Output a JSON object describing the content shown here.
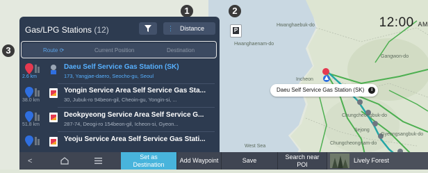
{
  "clock": {
    "time": "12:00",
    "ampm": "AM"
  },
  "panel": {
    "title": "Gas/LPG Stations",
    "count": "(12)",
    "sort_label": "Distance",
    "tabs": [
      "Route",
      "Current Position",
      "Destination"
    ]
  },
  "stations": [
    {
      "distance": "2.6 km",
      "name": "Daeu Self Service Gas Station (SK)",
      "address": "173, Yangjae-daero, Seocho-gu, Seoul"
    },
    {
      "distance": "38.0 km",
      "name": "Yongin Service Area Self Service Gas Sta...",
      "address": "30, Jubuk-ro 94beon-gil, Cheoin-gu, Yongin-si, ..."
    },
    {
      "distance": "51.8 km",
      "name": "Deokpyeong Service Area Self Service G...",
      "address": "287-74, Deogi-ro 154beon-gil, Icheon-si, Gyeon..."
    },
    {
      "distance": "",
      "name": "Yeoju Service Area Self Service Gas Stati...",
      "address": ""
    }
  ],
  "map": {
    "tooltip": "Daeu Self Service Gas Station (SK)",
    "labels": [
      "Hwanghaebuk-do",
      "Hwanghaenam-do",
      "Gangwon-do",
      "Incheon",
      "Chungcheongbuk-do",
      "Sejong",
      "Gyeongsangbuk-do",
      "Chungcheongnam-do",
      "West Sea"
    ]
  },
  "callouts": [
    "1",
    "2",
    "3"
  ],
  "parking_button": "P",
  "bottom_bar": {
    "set_destination": [
      "Set as",
      "Destination"
    ],
    "add_waypoint": "Add Waypoint",
    "save": "Save",
    "search_near_poi": [
      "Search near",
      "POI"
    ],
    "lively_forest": "Lively Forest"
  },
  "colors": {
    "panel_bg": "#2d3b50",
    "accent_blue": "#57b0ff",
    "set_dest_bg": "#48b4dc",
    "bottom_bar_bg": "#3f4552"
  },
  "icons": [
    "back-icon",
    "home-icon",
    "menu-icon",
    "filter-icon",
    "location-pin-icon",
    "gas-station-logo-icon",
    "info-icon",
    "current-location-icon"
  ]
}
